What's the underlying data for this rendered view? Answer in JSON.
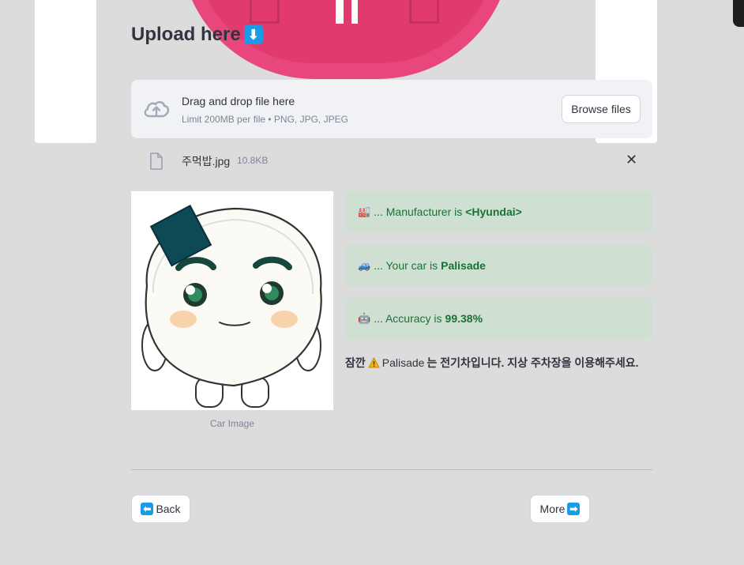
{
  "heading": {
    "text": "Upload here",
    "emoji": "⬇"
  },
  "uploader": {
    "title": "Drag and drop file here",
    "subtitle": "Limit 200MB per file • PNG, JPG, JPEG",
    "browse_label": "Browse files",
    "icon": "cloud-upload-icon"
  },
  "file": {
    "name": "주먹밥.jpg",
    "size": "10.8KB",
    "icon": "file-icon",
    "remove": "✕"
  },
  "image": {
    "caption": "Car Image"
  },
  "results": {
    "manufacturer": {
      "icon": "factory-icon",
      "prefix": "... Manufacturer is ",
      "value": "<Hyundai>"
    },
    "car": {
      "icon": "car-icon",
      "prefix": "... Your car is ",
      "value": "Palisade"
    },
    "accuracy": {
      "icon": "robot-icon",
      "prefix": "... Accuracy is ",
      "value": "99.38%"
    }
  },
  "notice": {
    "lead": "잠깐",
    "car": "Palisade",
    "rest": "는 전기차입니다. 지상 주차장을 이용해주세요.",
    "icon": "warning-icon"
  },
  "nav": {
    "back_label": "Back",
    "more_label": "More"
  },
  "colors": {
    "alert_bg": "#cfe0d2",
    "alert_text": "#177233",
    "accent": "#1a9be8"
  }
}
